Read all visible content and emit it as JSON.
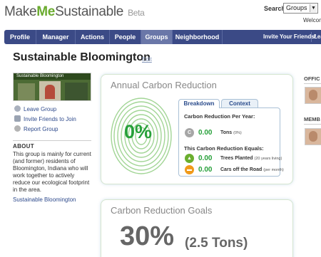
{
  "brand": {
    "word1": "Make",
    "word2": "Me",
    "word3": "Sustainable",
    "beta": "Beta"
  },
  "header": {
    "search_label": "Search",
    "search_selected": "Groups",
    "welcome": "Welcom"
  },
  "nav": {
    "items": [
      {
        "label": "Profile"
      },
      {
        "label": "Manager"
      },
      {
        "label": "Actions"
      },
      {
        "label": "People"
      },
      {
        "label": "Groups"
      },
      {
        "label": "Neighborhood"
      }
    ],
    "active": "Groups",
    "invite": "Invite Your Friends!",
    "extra": "Lea"
  },
  "page": {
    "title": "Sustainable Bloomington",
    "edit": "Edit"
  },
  "group_photo": {
    "banner": "Sustainable Bloomington"
  },
  "sidebar": {
    "leave": "Leave Group",
    "invite": "Invite Friends to Join",
    "report": "Report Group",
    "about_heading": "ABOUT",
    "about_text": "This group is mainly for current (and former) residents of Bloomington, Indiana who will work together to actively reduce our ecological footprint in the area.",
    "about_link": "Sustainable Bloomington"
  },
  "carbon": {
    "title": "Annual Carbon Reduction",
    "percent": "0%",
    "tabs": [
      "Breakdown",
      "Context"
    ],
    "per_year_label": "Carbon Reduction Per Year:",
    "tons_value": "0.00",
    "tons_unit": "Tons",
    "tons_pct": "(0%)",
    "equals_label": "This Carbon Reduction Equals:",
    "trees_value": "0.00",
    "trees_unit": "Trees Planted",
    "trees_note": "(20 years living)",
    "cars_value": "0.00",
    "cars_unit": "Cars off the Road",
    "cars_note": "(per month)",
    "icon_c": "C"
  },
  "goals": {
    "title": "Carbon Reduction Goals",
    "percent": "30%",
    "tons": "(2.5 Tons)"
  },
  "right": {
    "officers": "OFFIC",
    "members": "MEMB"
  },
  "colors": {
    "nav": "#3b4a86",
    "accent_green": "#27a03a",
    "brand_green": "#6aab2e",
    "orange": "#f09a1a"
  }
}
